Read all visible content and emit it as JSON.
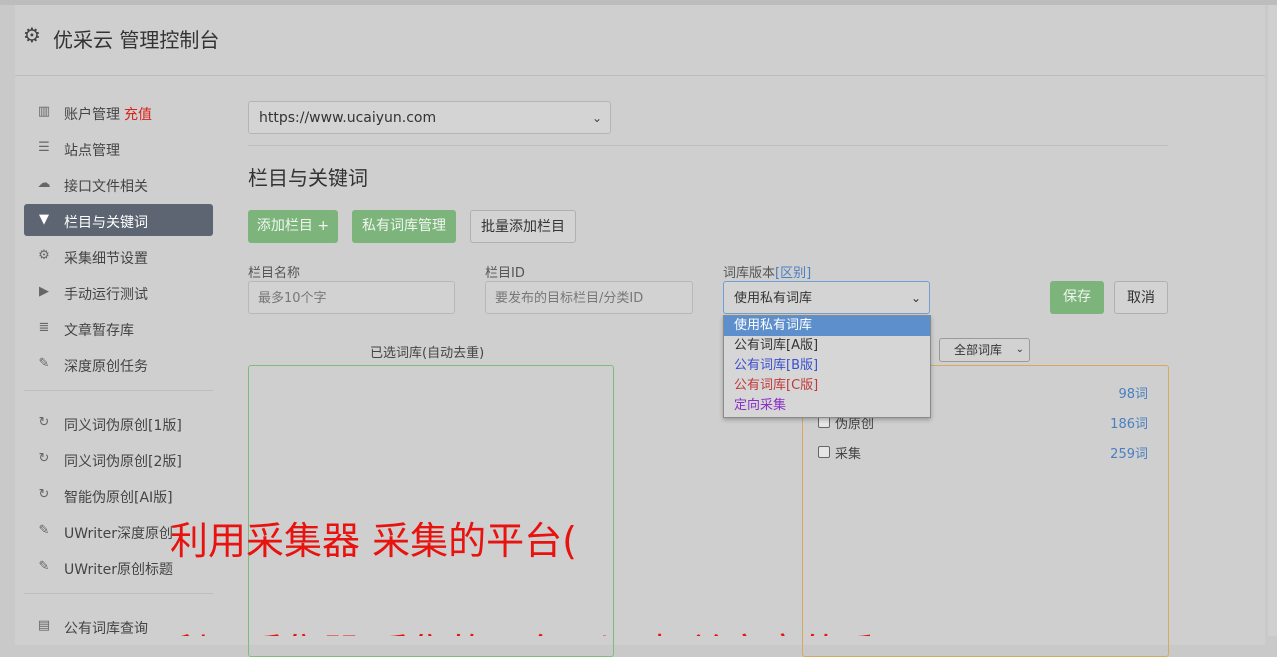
{
  "header": {
    "title": "优采云 管理控制台",
    "icon": "gear-icon"
  },
  "sidebar": {
    "group1": [
      {
        "label": "账户管理",
        "badge": "充值",
        "icon": "bar-chart-icon"
      },
      {
        "label": "站点管理",
        "icon": "server-icon"
      },
      {
        "label": "接口文件相关",
        "icon": "cloud-upload-icon"
      },
      {
        "label": "栏目与关键词",
        "icon": "filter-icon",
        "active": true
      },
      {
        "label": "采集细节设置",
        "icon": "cogs-icon"
      },
      {
        "label": "手动运行测试",
        "icon": "play-icon"
      },
      {
        "label": "文章暂存库",
        "icon": "database-icon"
      },
      {
        "label": "深度原创任务",
        "icon": "edit-icon"
      }
    ],
    "group2": [
      {
        "label": "同义词伪原创[1版]",
        "icon": "refresh-icon"
      },
      {
        "label": "同义词伪原创[2版]",
        "icon": "refresh-icon"
      },
      {
        "label": "智能伪原创[AI版]",
        "icon": "refresh-icon"
      },
      {
        "label": "UWriter深度原创",
        "icon": "edit-icon"
      },
      {
        "label": "UWriter原创标题",
        "icon": "edit-icon"
      }
    ],
    "group3": [
      {
        "label": "公有词库查询",
        "icon": "book-icon"
      }
    ]
  },
  "main": {
    "site_select": "https://www.ucaiyun.com",
    "section_title": "栏目与关键词",
    "buttons": {
      "add_column": "添加栏目 +",
      "private_lib": "私有词库管理",
      "batch_add": "批量添加栏目",
      "save": "保存",
      "cancel": "取消"
    },
    "fields": {
      "column_name_label": "栏目名称",
      "column_name_placeholder": "最多10个字",
      "column_id_label": "栏目ID",
      "column_id_placeholder": "要发布的目标栏目/分类ID",
      "lib_version_label": "词库版本",
      "lib_version_link": "[区别]",
      "lib_version_value": "使用私有词库"
    },
    "dropdown_options": [
      {
        "label": "使用私有词库",
        "selected": true,
        "color": "#ffffff"
      },
      {
        "label": "公有词库[A版]",
        "color": "#333333"
      },
      {
        "label": "公有词库[B版]",
        "color": "#3a4fd0"
      },
      {
        "label": "公有词库[C版]",
        "color": "#c0393b"
      },
      {
        "label": "定向采集",
        "color": "#8a2fc9"
      }
    ],
    "selected_panel_title": "已选词库(自动去重)",
    "lib_filter": "全部词库",
    "libraries": [
      {
        "name": "",
        "count": "98词"
      },
      {
        "name": "伪原创",
        "count": "186词"
      },
      {
        "name": "采集",
        "count": "259词"
      }
    ]
  },
  "overlay": {
    "line1": "利用采集器 采集的平台(",
    "line2": "利用采集器 采集的平台 以及相关文章的采集"
  }
}
